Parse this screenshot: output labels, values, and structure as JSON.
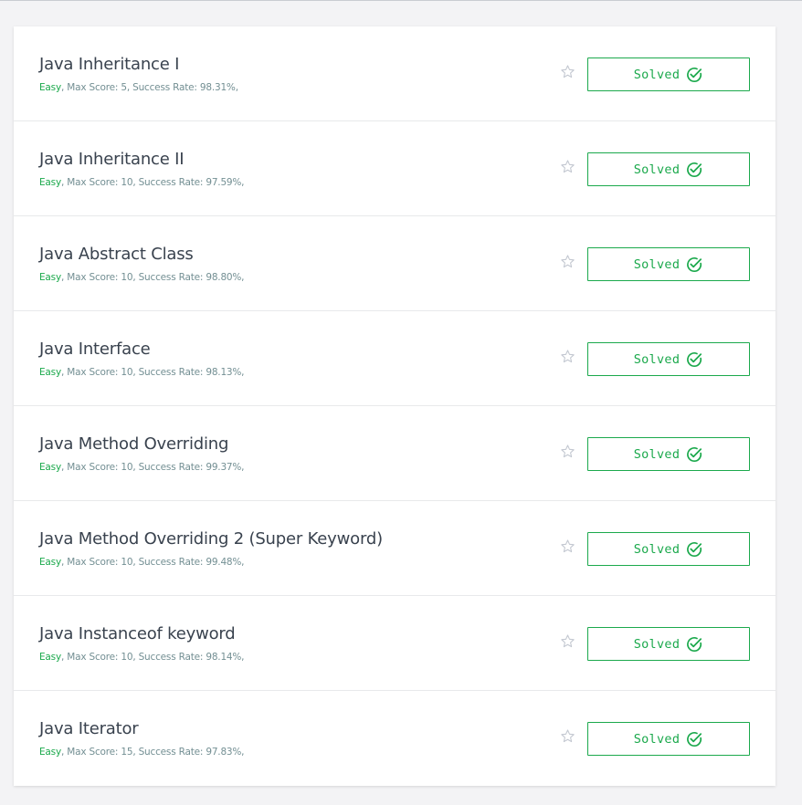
{
  "colors": {
    "accent": "#1ba94c",
    "title": "#39424e",
    "meta": "#738f93",
    "star": "#c2c7d0"
  },
  "icons": {
    "favorite": "star-outline-icon",
    "solved": "check-circle-icon"
  },
  "challenges": [
    {
      "title": "Java Inheritance I",
      "difficulty": "Easy",
      "meta": ", Max Score: 5, Success Rate: 98.31%,",
      "status": "Solved"
    },
    {
      "title": "Java Inheritance II",
      "difficulty": "Easy",
      "meta": ", Max Score: 10, Success Rate: 97.59%,",
      "status": "Solved"
    },
    {
      "title": "Java Abstract Class",
      "difficulty": "Easy",
      "meta": ", Max Score: 10, Success Rate: 98.80%,",
      "status": "Solved"
    },
    {
      "title": "Java Interface",
      "difficulty": "Easy",
      "meta": ", Max Score: 10, Success Rate: 98.13%,",
      "status": "Solved"
    },
    {
      "title": "Java Method Overriding",
      "difficulty": "Easy",
      "meta": ", Max Score: 10, Success Rate: 99.37%,",
      "status": "Solved"
    },
    {
      "title": "Java Method Overriding 2 (Super Keyword)",
      "difficulty": "Easy",
      "meta": ", Max Score: 10, Success Rate: 99.48%,",
      "status": "Solved"
    },
    {
      "title": "Java Instanceof keyword",
      "difficulty": "Easy",
      "meta": ", Max Score: 10, Success Rate: 98.14%,",
      "status": "Solved"
    },
    {
      "title": "Java Iterator",
      "difficulty": "Easy",
      "meta": ", Max Score: 15, Success Rate: 97.83%,",
      "status": "Solved"
    }
  ]
}
